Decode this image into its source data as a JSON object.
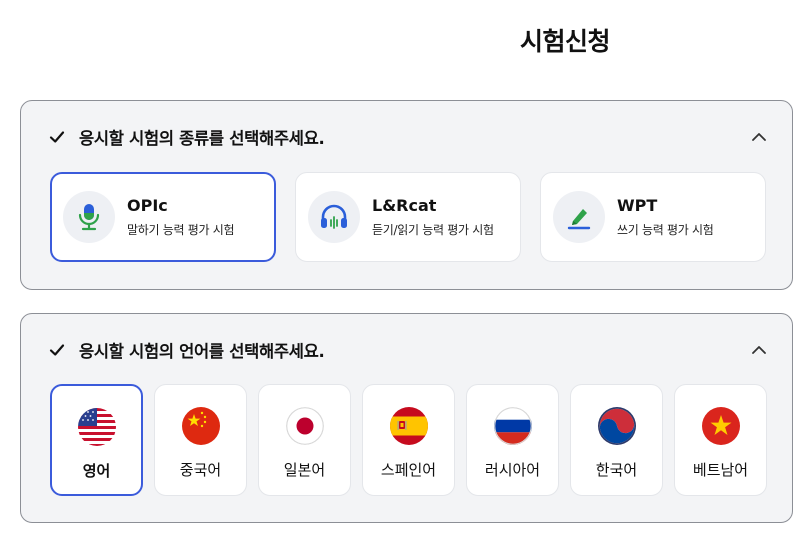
{
  "page": {
    "title": "시험신청"
  },
  "colors": {
    "accent": "#3b5bdb",
    "panel_bg": "#f3f4f6",
    "icon_green": "#2fa24a",
    "icon_blue": "#2b5fd9"
  },
  "exam_type_section": {
    "title": "응시할 시험의 종류를 선택해주세요.",
    "check_icon": "checkmark-icon",
    "collapse_icon": "chevron-up-icon",
    "options": [
      {
        "name": "OPIc",
        "description": "말하기 능력 평가 시험",
        "icon": "microphone-icon",
        "selected": true
      },
      {
        "name": "L&Rcat",
        "description": "듣기/읽기 능력 평가 시험",
        "icon": "headphones-icon",
        "selected": false
      },
      {
        "name": "WPT",
        "description": "쓰기 능력 평가 시험",
        "icon": "pen-icon",
        "selected": false
      }
    ]
  },
  "language_section": {
    "title": "응시할 시험의 언어를 선택해주세요.",
    "check_icon": "checkmark-icon",
    "collapse_icon": "chevron-up-icon",
    "options": [
      {
        "label": "영어",
        "flag": "us-flag-icon",
        "selected": true
      },
      {
        "label": "중국어",
        "flag": "china-flag-icon",
        "selected": false
      },
      {
        "label": "일본어",
        "flag": "japan-flag-icon",
        "selected": false
      },
      {
        "label": "스페인어",
        "flag": "spain-flag-icon",
        "selected": false
      },
      {
        "label": "러시아어",
        "flag": "russia-flag-icon",
        "selected": false
      },
      {
        "label": "한국어",
        "flag": "korea-flag-icon",
        "selected": false
      },
      {
        "label": "베트남어",
        "flag": "vietnam-flag-icon",
        "selected": false
      }
    ]
  }
}
